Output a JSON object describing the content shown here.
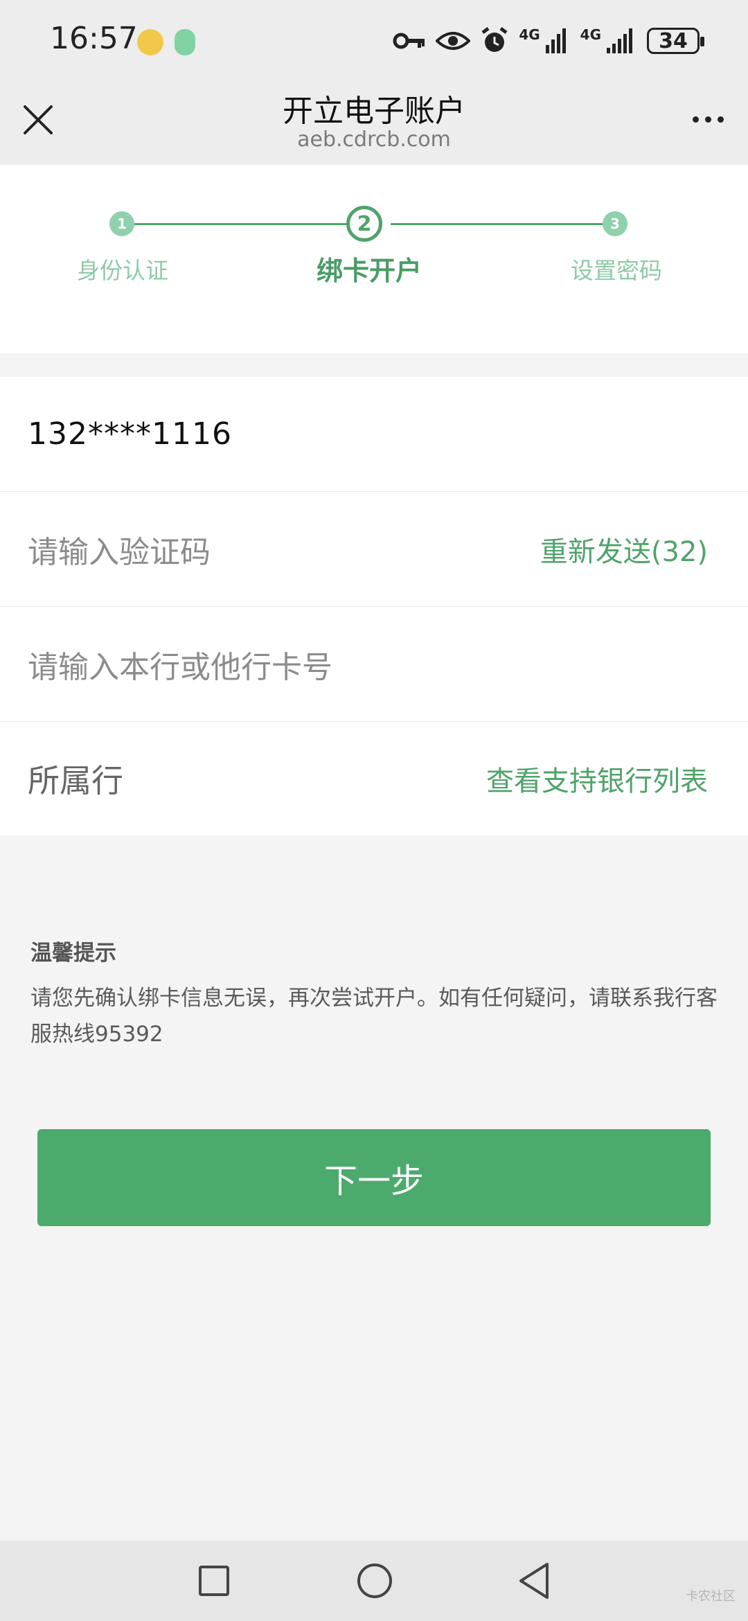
{
  "status_bar": {
    "time": "16:57",
    "network_1": "4G",
    "network_2": "4G",
    "battery": "34",
    "icons": [
      "key-icon",
      "eye-icon",
      "alarm-icon",
      "signal-icon",
      "signal-icon",
      "battery-icon"
    ]
  },
  "header": {
    "title": "开立电子账户",
    "subtitle": "aeb.cdrcb.com",
    "close_icon": "close-icon",
    "more_icon": "more-icon"
  },
  "stepper": {
    "steps": [
      {
        "number": "1",
        "label": "身份认证"
      },
      {
        "number": "2",
        "label": "绑卡开户"
      },
      {
        "number": "3",
        "label": "设置密码"
      }
    ],
    "active_step": 2
  },
  "form": {
    "phone_value": "132****1116",
    "code_placeholder": "请输入验证码",
    "resend_label": "重新发送(32)",
    "card_placeholder": "请输入本行或他行卡号",
    "bank_label": "所属行",
    "bank_list_link": "查看支持银行列表"
  },
  "tips": {
    "title": "温馨提示",
    "body": "请您先确认绑卡信息无误，再次尝试开户。如有任何疑问，请联系我行客服热线95392"
  },
  "next_button": "下一步",
  "watermark": "卡农社区",
  "colors": {
    "accent": "#4fa36a",
    "button": "#4caa6c",
    "step_inactive": "#8fd0ad",
    "background": "#f4f4f4"
  }
}
